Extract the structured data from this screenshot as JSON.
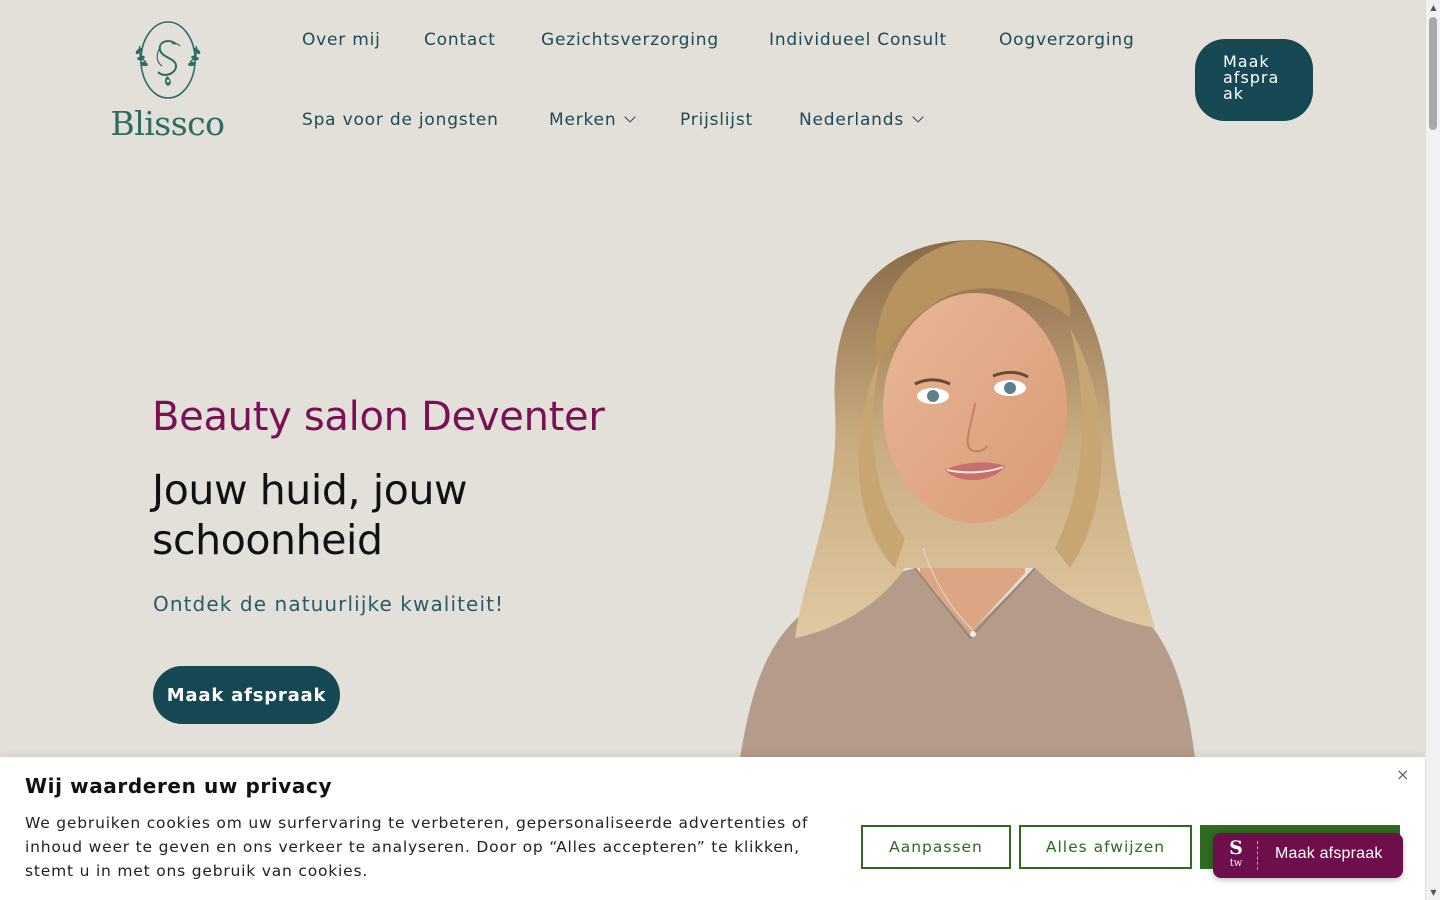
{
  "brand": {
    "name": "Blissco"
  },
  "nav": {
    "items": [
      {
        "label": "Over mij"
      },
      {
        "label": "Contact"
      },
      {
        "label": "Gezichtsverzorging"
      },
      {
        "label": "Individueel Consult"
      },
      {
        "label": "Oogverzorging"
      },
      {
        "label": "Spa voor de jongsten"
      },
      {
        "label": "Merken",
        "dropdown": true
      },
      {
        "label": "Prijslijst"
      },
      {
        "label": "Nederlands",
        "dropdown": true
      }
    ],
    "cta_label": "Maak afspraak"
  },
  "hero": {
    "kicker": "Beauty salon Deventer",
    "title": "Jouw huid, jouw schoonheid",
    "subtitle": "Ontdek de natuurlijke kwaliteit!",
    "cta_label": "Maak afspraak"
  },
  "cookie": {
    "title": "Wij waarderen uw privacy",
    "text": "We gebruiken cookies om uw surfervaring te verbeteren, gepersonaliseerde advertenties of inhoud weer te geven en ons verkeer te analyseren. Door op “Alles accepteren” te klikken, stemt u in met ons gebruik van cookies.",
    "customize_label": "Aanpassen",
    "reject_label": "Alles afwijzen",
    "close_icon": "×"
  },
  "booking_widget": {
    "label": "Maak afspraak",
    "logo_s": "S",
    "logo_tw": "tw"
  },
  "colors": {
    "background": "#e2e0d9",
    "primary": "#164854",
    "accent": "#7a1055",
    "cookie_green": "#2e6a1f",
    "widget": "#6e0f4c"
  }
}
